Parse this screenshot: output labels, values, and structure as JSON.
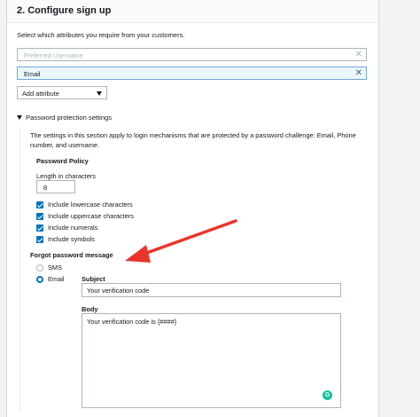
{
  "header": {
    "title": "2. Configure sign up"
  },
  "intro": "Select which attributes you require from your customers.",
  "attributes": {
    "placeholder_row": {
      "text": "Preferred Username",
      "remove_icon": "close-icon"
    },
    "selected_row": {
      "text": "Email",
      "remove_icon": "close-icon"
    },
    "add_attribute_label": "Add attribute"
  },
  "password_section": {
    "toggle_label": "Password protection settings",
    "description": "The settings in this section apply to login mechanisms that are protected by a password challenge: Email, Phone number, and username.",
    "policy_heading": "Password Policy",
    "length_label": "Length in characters",
    "length_value": "8",
    "checks": [
      {
        "label": "Include lowercase characters",
        "checked": true
      },
      {
        "label": "Include uppercase characters",
        "checked": true
      },
      {
        "label": "Include numerals",
        "checked": true
      },
      {
        "label": "Include symbols",
        "checked": true
      }
    ]
  },
  "forgot_password": {
    "heading": "Forgot password message",
    "options": [
      {
        "label": "SMS",
        "selected": false
      },
      {
        "label": "Email",
        "selected": true
      }
    ],
    "subject_label": "Subject",
    "subject_value": "Your verification code",
    "body_label": "Body",
    "body_value": "Your verification code is {####}",
    "grammarly_glyph": "G"
  },
  "colors": {
    "accent": "#0073bb",
    "annotation_arrow": "#e8352b",
    "grammarly": "#15c39a"
  }
}
